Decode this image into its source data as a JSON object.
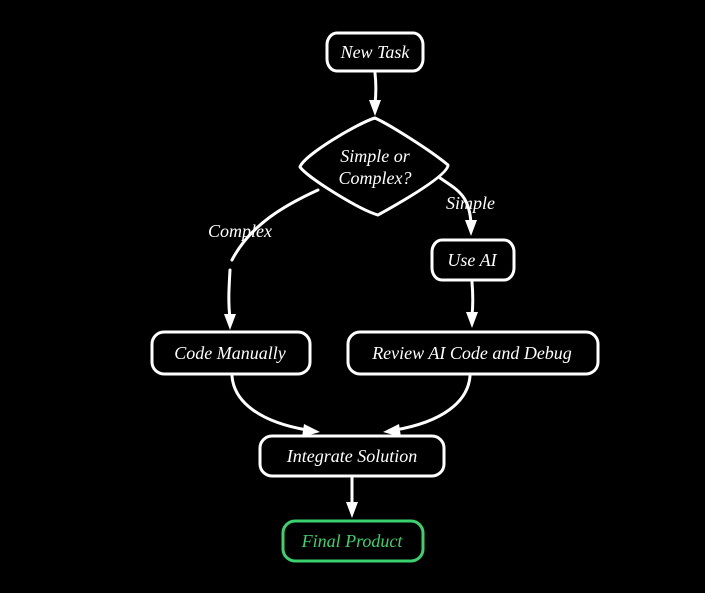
{
  "flowchart": {
    "nodes": {
      "new_task": {
        "label": "New Task"
      },
      "decision": {
        "line1": "Simple or",
        "line2": "Complex?"
      },
      "use_ai": {
        "label": "Use AI"
      },
      "code_manually": {
        "label": "Code Manually"
      },
      "review": {
        "label": "Review AI Code and Debug"
      },
      "integrate": {
        "label": "Integrate Solution"
      },
      "final": {
        "label": "Final Product"
      }
    },
    "edges": {
      "simple": {
        "label": "Simple"
      },
      "complex": {
        "label": "Complex"
      }
    },
    "colors": {
      "stroke": "#ffffff",
      "accent": "#3bd16f",
      "background": "#000000"
    }
  }
}
